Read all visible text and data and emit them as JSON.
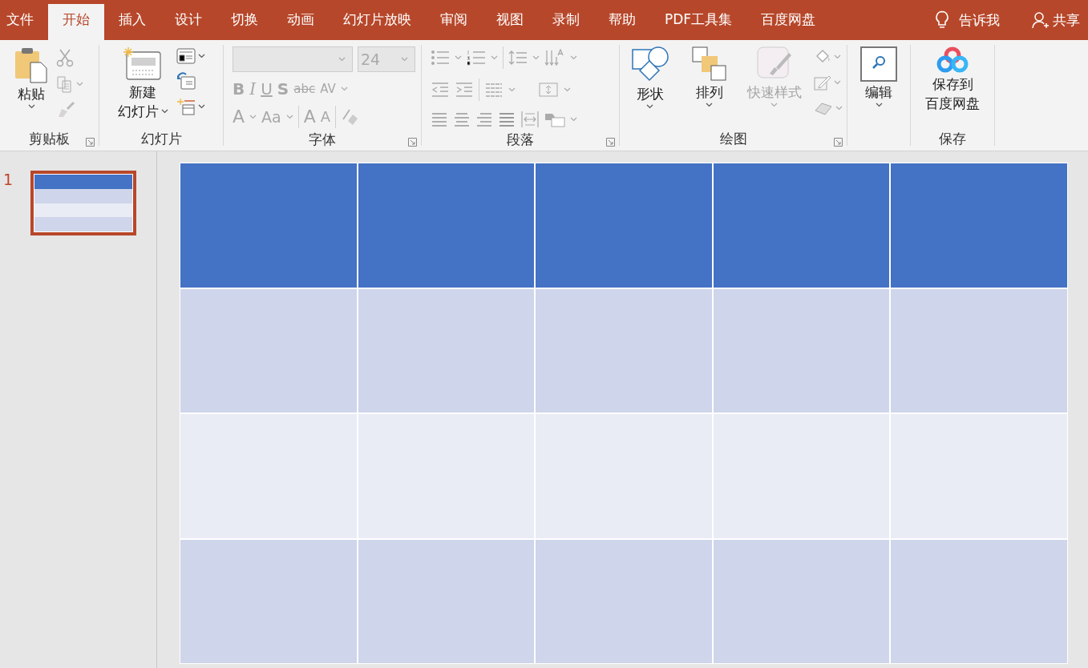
{
  "menu_tabs": [
    {
      "label": "文件",
      "selected": false
    },
    {
      "label": "开始",
      "selected": true
    },
    {
      "label": "插入",
      "selected": false
    },
    {
      "label": "设计",
      "selected": false
    },
    {
      "label": "切换",
      "selected": false
    },
    {
      "label": "动画",
      "selected": false
    },
    {
      "label": "幻灯片放映",
      "selected": false
    },
    {
      "label": "审阅",
      "selected": false
    },
    {
      "label": "视图",
      "selected": false
    },
    {
      "label": "录制",
      "selected": false
    },
    {
      "label": "帮助",
      "selected": false
    },
    {
      "label": "PDF工具集",
      "selected": false
    },
    {
      "label": "百度网盘",
      "selected": false
    }
  ],
  "tell_me": "告诉我",
  "share": "共享",
  "ribbon": {
    "clipboard": {
      "paste": "粘贴",
      "label": "剪贴板"
    },
    "slides": {
      "new_slide": [
        "新建",
        "幻灯片"
      ],
      "label": "幻灯片"
    },
    "font": {
      "size": "24",
      "format_buttons": [
        "B",
        "I",
        "U",
        "S",
        "abc",
        "AV"
      ],
      "color_button": "A",
      "case_button": "Aa",
      "grow_button": "A",
      "shrink_button": "A",
      "label": "字体"
    },
    "paragraph": {
      "label": "段落"
    },
    "drawing": {
      "buttons": [
        {
          "label": "形状",
          "kind": "shapes",
          "disabled": false
        },
        {
          "label": "排列",
          "kind": "arrange",
          "disabled": false
        },
        {
          "label": "快速样式",
          "kind": "styles",
          "disabled": true
        }
      ],
      "label": "绘图"
    },
    "editing": {
      "button": "编辑"
    },
    "save": {
      "button": [
        "保存到",
        "百度网盘"
      ],
      "label": "保存"
    }
  },
  "slides": [
    {
      "number": "1",
      "selected": true
    }
  ],
  "table": {
    "rows": [
      {
        "kind": "header",
        "cells": [
          {
            "kind": "empty"
          },
          {
            "kind": "empty"
          },
          {
            "kind": "empty"
          },
          {
            "kind": "empty"
          },
          {
            "kind": "empty"
          }
        ]
      },
      {
        "kind": "band",
        "cells": [
          {
            "kind": "empty"
          },
          {
            "kind": "empty"
          },
          {
            "kind": "empty"
          },
          {
            "kind": "empty"
          },
          {
            "kind": "empty"
          }
        ]
      },
      {
        "kind": "plain",
        "cells": [
          {
            "kind": "empty"
          },
          {
            "kind": "empty"
          },
          {
            "kind": "empty"
          },
          {
            "kind": "empty"
          },
          {
            "kind": "empty"
          }
        ]
      },
      {
        "kind": "band",
        "cells": [
          {
            "kind": "empty"
          },
          {
            "kind": "empty"
          },
          {
            "kind": "empty"
          },
          {
            "kind": "empty"
          },
          {
            "kind": "empty"
          }
        ]
      }
    ]
  }
}
